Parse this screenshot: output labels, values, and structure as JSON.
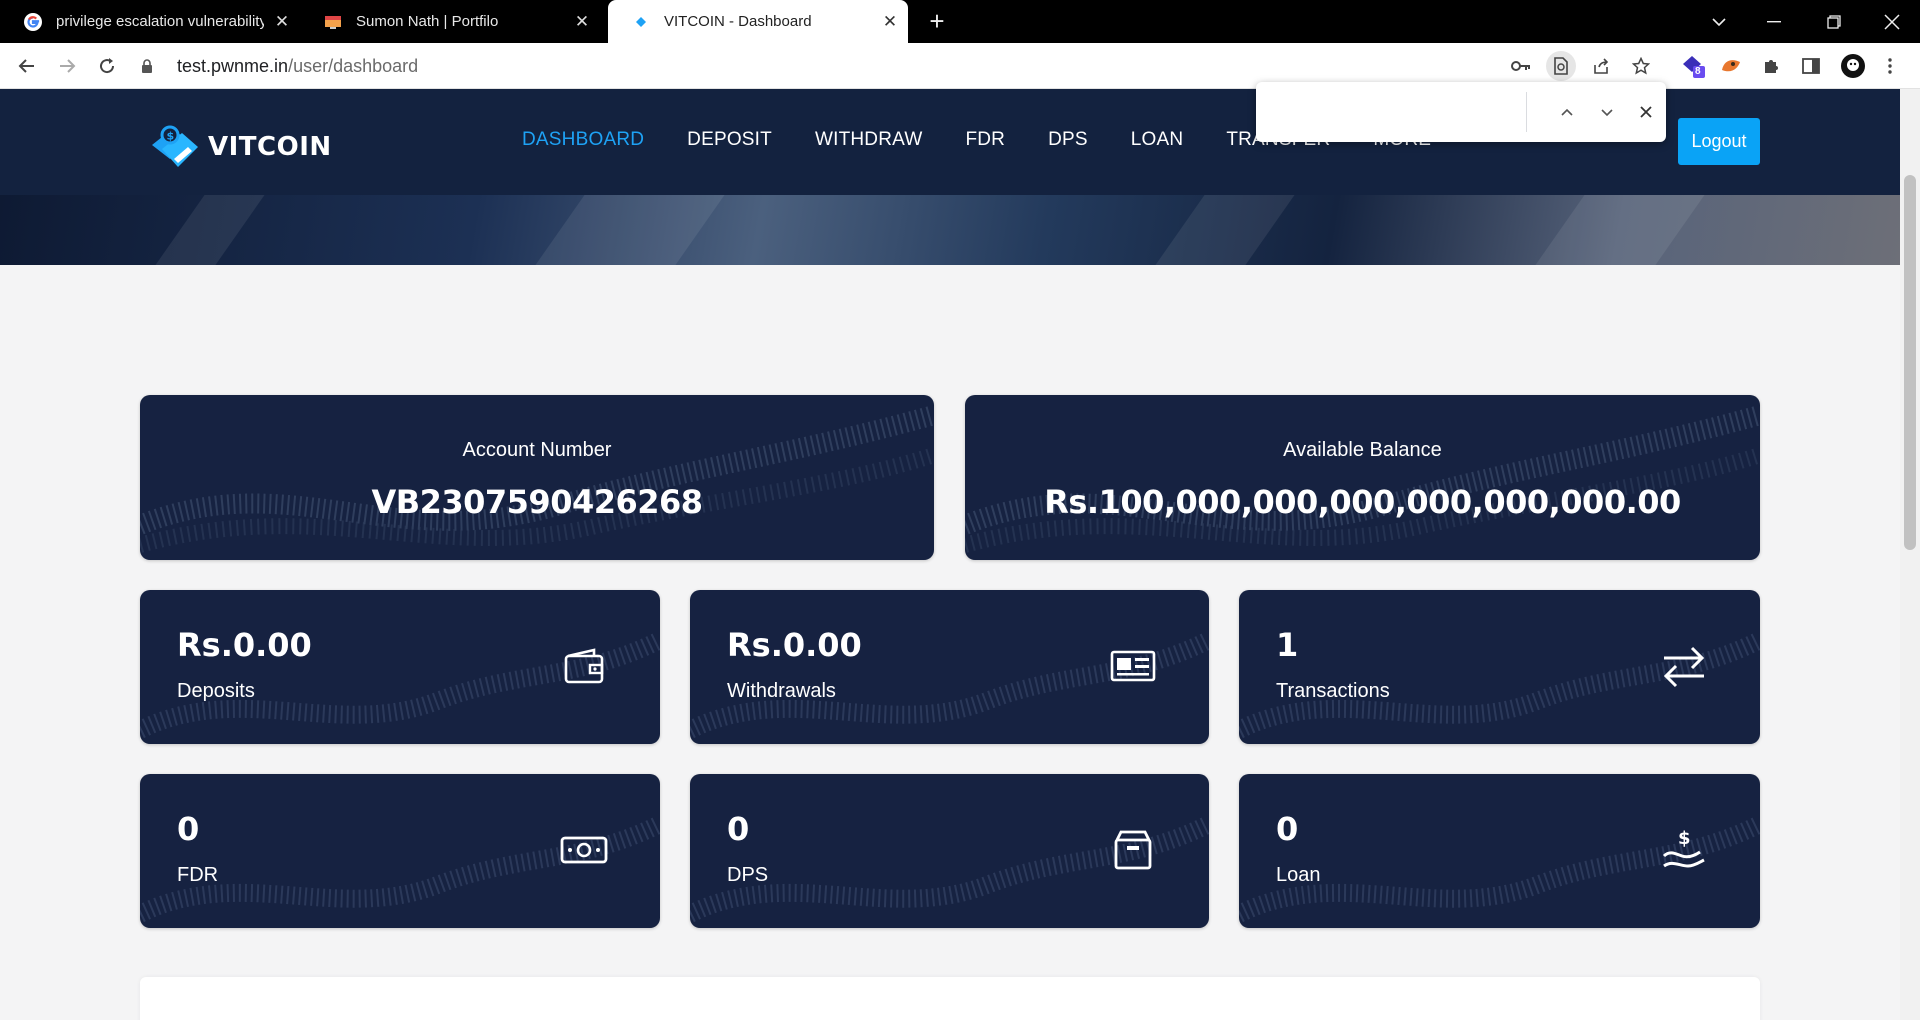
{
  "browser": {
    "tabs": [
      {
        "title": "privilege escalation vulnerability",
        "icon": "google-icon",
        "active": false
      },
      {
        "title": "Sumon Nath | Portfilo",
        "icon": "portfolio-icon",
        "active": false
      },
      {
        "title": "VITCOIN - Dashboard",
        "icon": "vitcoin-icon",
        "active": true
      }
    ],
    "url_host": "test.pwnme.in",
    "url_path": "/user/dashboard",
    "extension_badge": "8"
  },
  "site": {
    "logo_text": "VITCOIN",
    "nav": [
      "DASHBOARD",
      "DEPOSIT",
      "WITHDRAW",
      "FDR",
      "DPS",
      "LOAN",
      "TRANSFER",
      "MORE"
    ],
    "active_nav": "DASHBOARD",
    "logout_label": "Logout",
    "accent_color": "#1ea2f5",
    "header_color": "#13223f",
    "card_color": "#162241"
  },
  "find_bar": {
    "value": ""
  },
  "summary": {
    "account_label": "Account Number",
    "account_value": "VB2307590426268",
    "balance_label": "Available Balance",
    "balance_value": "Rs.100,000,000,000,000,000,000.00"
  },
  "stats": [
    {
      "value": "Rs.0.00",
      "label": "Deposits",
      "icon": "wallet-icon"
    },
    {
      "value": "Rs.0.00",
      "label": "Withdrawals",
      "icon": "withdraw-card-icon"
    },
    {
      "value": "1",
      "label": "Transactions",
      "icon": "exchange-arrows-icon"
    },
    {
      "value": "0",
      "label": "FDR",
      "icon": "money-bill-icon"
    },
    {
      "value": "0",
      "label": "DPS",
      "icon": "box-icon"
    },
    {
      "value": "0",
      "label": "Loan",
      "icon": "hand-dollar-icon"
    }
  ]
}
